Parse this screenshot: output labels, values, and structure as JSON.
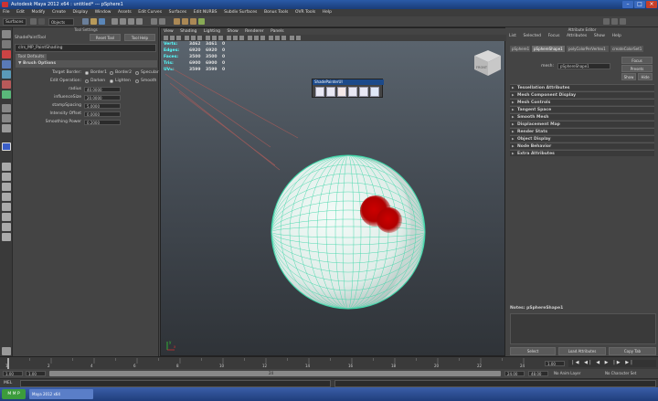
{
  "window": {
    "title": "Autodesk Maya 2012 x64 : untitled* --- pSphere1"
  },
  "menubar": [
    "File",
    "Edit",
    "Modify",
    "Create",
    "Display",
    "Window",
    "Assets",
    "Edit Curves",
    "Surfaces",
    "Edit NURBS",
    "Subdiv Surfaces",
    "Bonus Tools",
    "OVR Tools",
    "Help"
  ],
  "statusline": {
    "mode": "Surfaces",
    "select_mode": "Objects"
  },
  "tool_settings": {
    "panel_title": "Tool Settings",
    "tool_name": "ShadePaintTool",
    "reset_button": "Reset Tool",
    "help_button": "Tool Help",
    "context_name": "clrs_MP_PaintShading",
    "tab": "Tool Defaults",
    "frame": "Brush Options",
    "target_border": {
      "label": "Target Border:",
      "options": [
        "Border1",
        "Border2",
        "Specular"
      ],
      "selected": 0
    },
    "edit_operation": {
      "label": "Edit Operation:",
      "options": [
        "Darken",
        "Lighten",
        "Smooth"
      ],
      "selected": 1
    },
    "fields": [
      {
        "label": "radius",
        "value": "40.0000"
      },
      {
        "label": "influenceSize",
        "value": "20.0000"
      },
      {
        "label": "stampSpacing",
        "value": "5.0000"
      },
      {
        "label": "Intensity Offset",
        "value": "0.0000"
      },
      {
        "label": "Smoothing Power",
        "value": "0.2000"
      }
    ]
  },
  "viewport": {
    "menu": [
      "View",
      "Shading",
      "Lighting",
      "Show",
      "Renderer",
      "Panels"
    ],
    "hud": [
      {
        "label": "Verts:",
        "v1": "3462",
        "v2": "3461",
        "v3": "0"
      },
      {
        "label": "Edges:",
        "v1": "6920",
        "v2": "6920",
        "v3": "0"
      },
      {
        "label": "Faces:",
        "v1": "3500",
        "v2": "3500",
        "v3": "0"
      },
      {
        "label": "Tris:",
        "v1": "6900",
        "v2": "6900",
        "v3": "0"
      },
      {
        "label": "UVs:",
        "v1": "3599",
        "v2": "3599",
        "v3": "0"
      }
    ],
    "axis_x": "x",
    "axis_y": "y",
    "cube_label": "FRONT"
  },
  "shelf": {
    "title": "ShadePainterUI"
  },
  "attribute_editor": {
    "title": "Attribute Editor",
    "menu": [
      "List",
      "Selected",
      "Focus",
      "Attributes",
      "Show",
      "Help"
    ],
    "tabs": [
      "pSphere1",
      "pSphereShape1",
      "polyColorPerVertex1",
      "createColorSet1"
    ],
    "active_tab": 1,
    "mesh_label": "mesh:",
    "mesh_value": "pSphereShape1",
    "focus_button": "Focus",
    "presets_button": "Presets",
    "show_button": "Show",
    "hide_button": "Hide",
    "sections": [
      "Tessellation Attributes",
      "Mesh Component Display",
      "Mesh Controls",
      "Tangent Space",
      "Smooth Mesh",
      "Displacement Map",
      "Render Stats",
      "Object Display",
      "Node Behavior",
      "Extra Attributes"
    ],
    "notes_label": "Notes: pSphereShape1",
    "select_button": "Select",
    "load_button": "Load Attributes",
    "copy_button": "Copy Tab"
  },
  "timeslider": {
    "ticks": [
      "1",
      "2",
      "4",
      "6",
      "8",
      "10",
      "12",
      "14",
      "16",
      "18",
      "20",
      "22",
      "24"
    ],
    "current_frame": "1.00"
  },
  "rangebar": {
    "start": "1.00",
    "range_start": "1.00",
    "range_marker": "24",
    "range_end": "24.00",
    "end": "48.00",
    "anim_layer": "No Anim Layer",
    "char_set": "No Character Set"
  },
  "cmdline": {
    "lang": "MEL"
  },
  "taskbar": {
    "start": "M M P",
    "task": "Maya 2012 x64"
  }
}
